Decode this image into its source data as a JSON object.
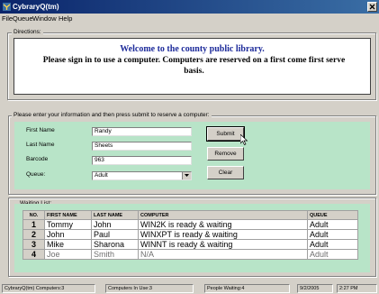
{
  "window": {
    "title": "CybraryQ(tm)"
  },
  "menu": [
    "File",
    "Queue",
    "Window",
    "Help"
  ],
  "directions": {
    "group_label": "Directions:",
    "welcome": "Welcome to the county public library.",
    "message": "Please sign in to use a computer.  Computers are reserved on a first come first serve basis."
  },
  "form": {
    "group_label": "Please enter your information and then press submit to reserve a computer:",
    "first_name_label": "First Name",
    "first_name_value": "Randy",
    "last_name_label": "Last Name",
    "last_name_value": "Sheets",
    "barcode_label": "Barcode",
    "barcode_value": "963",
    "queue_label": "Queue:",
    "queue_value": "Adult",
    "submit_label": "Submit",
    "remove_label": "Remove",
    "clear_label": "Clear"
  },
  "waiting": {
    "group_label": "Waiting List:",
    "headers": [
      "NO.",
      "FIRST NAME",
      "LAST NAME",
      "COMPUTER",
      "QUEUE"
    ],
    "rows": [
      [
        "1",
        "Tommy",
        "John",
        "WIN2K is ready & waiting",
        "Adult"
      ],
      [
        "2",
        "John",
        "Paul",
        "WINXPT is ready & waiting",
        "Adult"
      ],
      [
        "3",
        "Mike",
        "Sharona",
        "WINNT is ready & waiting",
        "Adult"
      ],
      [
        "4",
        "Joe",
        "Smith",
        "N/A",
        "Adult"
      ]
    ]
  },
  "status": {
    "app": "CybraryQ(tm) Computers:3",
    "in_use": "Computers In Use:3",
    "waiting": "People Waiting:4",
    "date": "9/2/2005",
    "time": "2:27 PM"
  },
  "colors": {
    "titlebar": "#0a246a",
    "panel_green": "#b8e4c8",
    "welcome_text": "#1c2a9a"
  }
}
